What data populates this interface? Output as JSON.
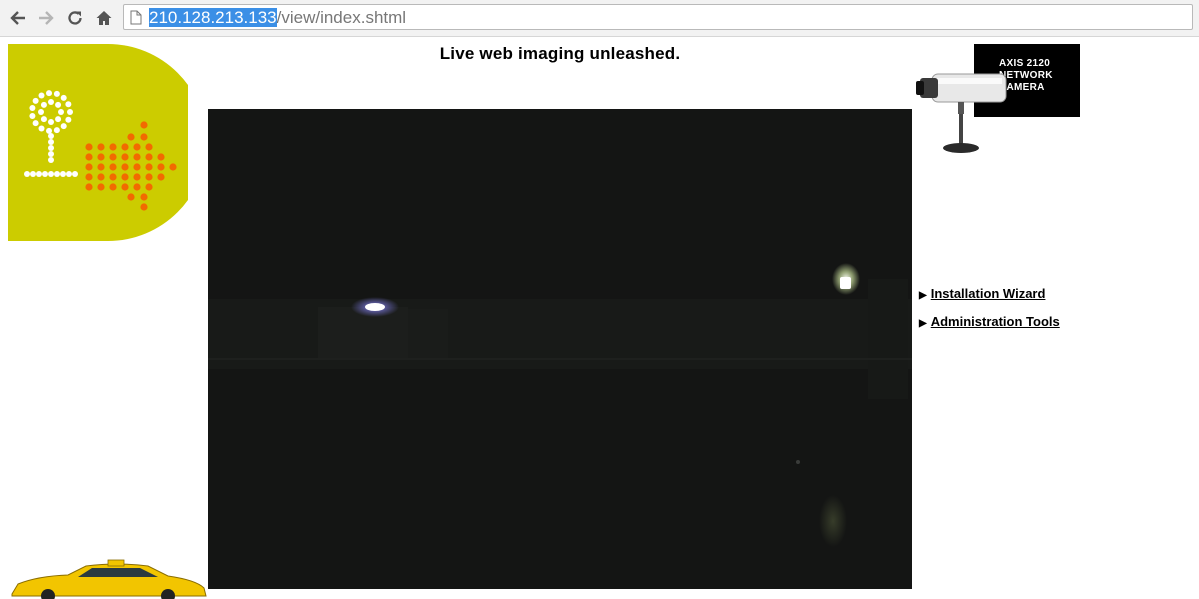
{
  "browser": {
    "back_icon": "back-arrow-icon",
    "forward_icon": "forward-arrow-icon",
    "reload_icon": "reload-icon",
    "home_icon": "home-icon",
    "page_icon": "page-icon",
    "url_host": "210.128.213.133",
    "url_path": "/view/index.shtml"
  },
  "page": {
    "headline": "Live web imaging unleashed.",
    "brand": {
      "line1": "AXIS 2120",
      "line2": "NETWORK",
      "line3": "CAMERA"
    },
    "menu": [
      {
        "label": "Installation Wizard"
      },
      {
        "label": "Administration Tools"
      }
    ],
    "colors": {
      "logo_green": "#cccc00",
      "logo_orange": "#f26a00",
      "video_bg": "#141514",
      "url_highlight": "#3b8fe6"
    }
  }
}
